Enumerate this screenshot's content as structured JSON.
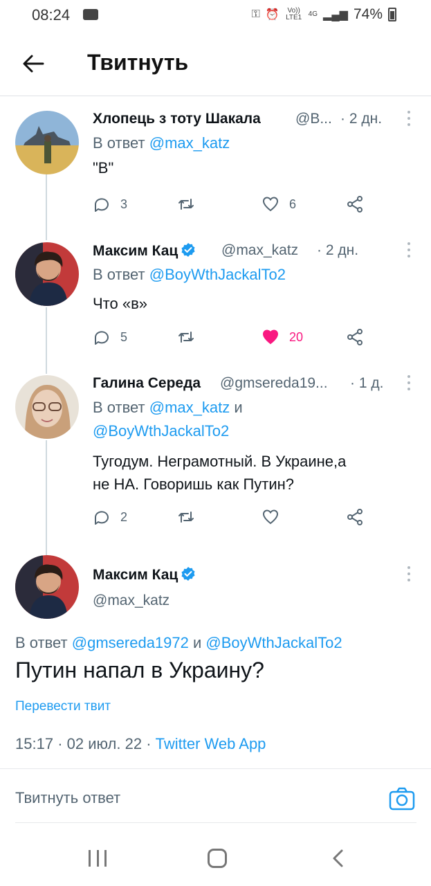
{
  "status_bar": {
    "time": "08:24",
    "network_small": "Vo)) LTE1",
    "network_4g": "4G",
    "battery": "74%"
  },
  "header": {
    "title": "Твитнуть"
  },
  "tweets": [
    {
      "name": "Хлопець з тоту Шакала",
      "handle": "@B...",
      "time": "· 2 дн.",
      "reply_prefix": "В ответ",
      "reply_to": "@max_katz",
      "reply_connector": "",
      "reply_to_2": "",
      "text": "\"B\"",
      "replies": "3",
      "retweets": "",
      "likes": "6",
      "liked": false,
      "verified": false
    },
    {
      "name": "Максим Кац",
      "handle": "@max_katz",
      "time": "· 2 дн.",
      "reply_prefix": "В ответ",
      "reply_to": "@BoyWthJackalTo2",
      "text": "Что «в»",
      "replies": "5",
      "retweets": "",
      "likes": "20",
      "liked": true,
      "verified": true
    },
    {
      "name": "Галина Середа",
      "handle": "@gmsereda19...",
      "time": "· 1 д.",
      "reply_prefix": "В ответ",
      "reply_to": "@max_katz",
      "reply_connector": "и",
      "reply_to_2": "@BoyWthJackalTo2",
      "text_line1": "Тугодум. Неграмотный. В Украине,а",
      "text_line2": "не НА. Говоришь как Путин?",
      "replies": "2",
      "retweets": "",
      "likes": "",
      "liked": false,
      "verified": false
    }
  ],
  "main_tweet": {
    "name": "Максим Кац",
    "handle": "@max_katz",
    "verified": true,
    "reply_prefix": "В ответ",
    "reply_to": "@gmsereda1972",
    "reply_connector": "и",
    "reply_to_2": "@BoyWthJackalTo2",
    "text": "Путин напал в Украину?",
    "translate": "Перевести твит",
    "time": "15:17",
    "date": "02 июл. 22",
    "source": "Twitter Web App",
    "separator": "·"
  },
  "compose": {
    "placeholder": "Твитнуть ответ"
  },
  "colors": {
    "accent": "#1d9bf0",
    "like": "#f91880",
    "muted": "#536471",
    "text": "#0f1419"
  }
}
